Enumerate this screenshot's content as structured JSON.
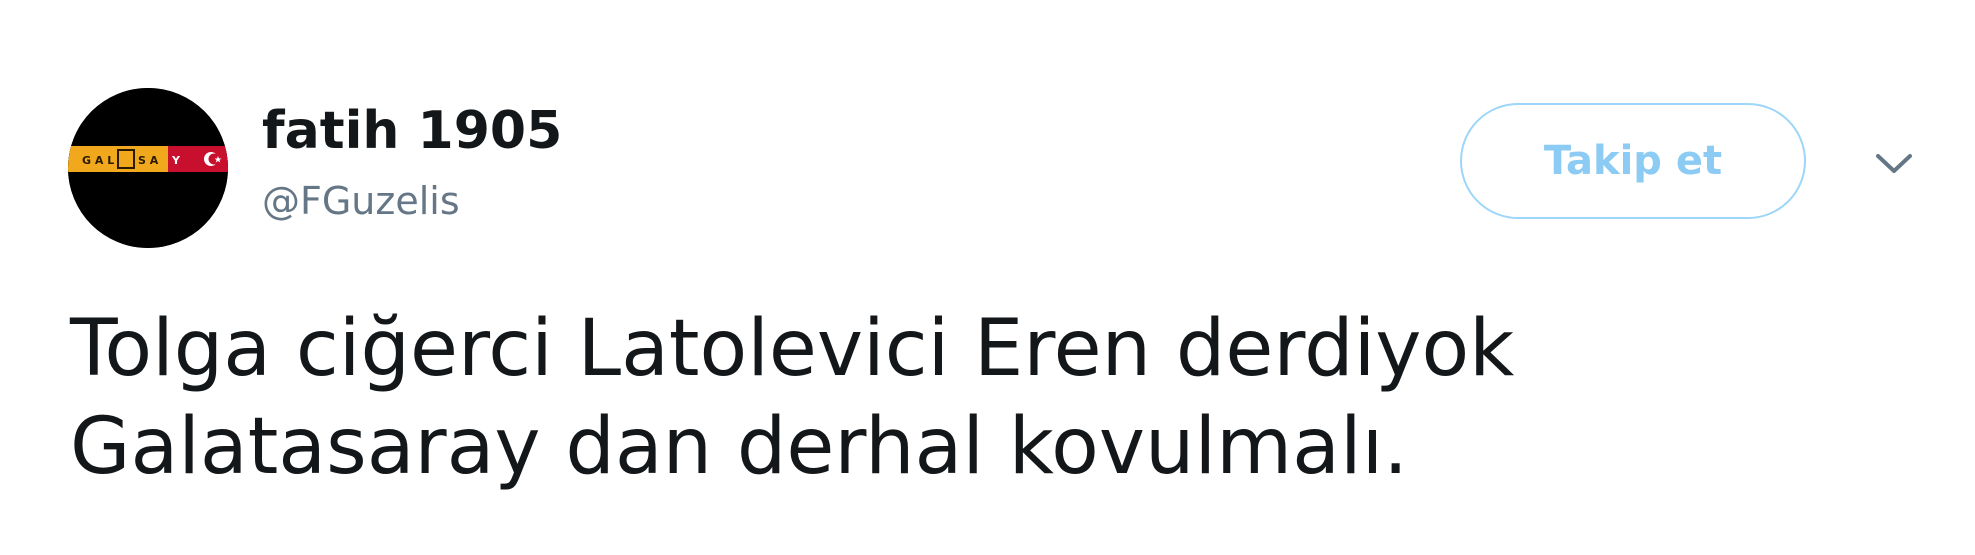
{
  "tweet": {
    "author": {
      "display_name": "fatih 1905",
      "handle": "@FGuzelis",
      "avatar_icon": "galatasaray-banner-avatar",
      "avatar_colors": {
        "background": "#000000",
        "band_yellow": "#f2a81d",
        "band_red": "#c8102e"
      }
    },
    "follow_button": {
      "label": "Takip et",
      "border_color": "#9dd6f8",
      "text_color": "#8ccbf3"
    },
    "menu_icon": "chevron-down-icon",
    "text_lines": [
      "Tolga ciğerci Latolevici Eren derdiyok",
      "Galatasaray dan derhal kovulmalı."
    ]
  }
}
